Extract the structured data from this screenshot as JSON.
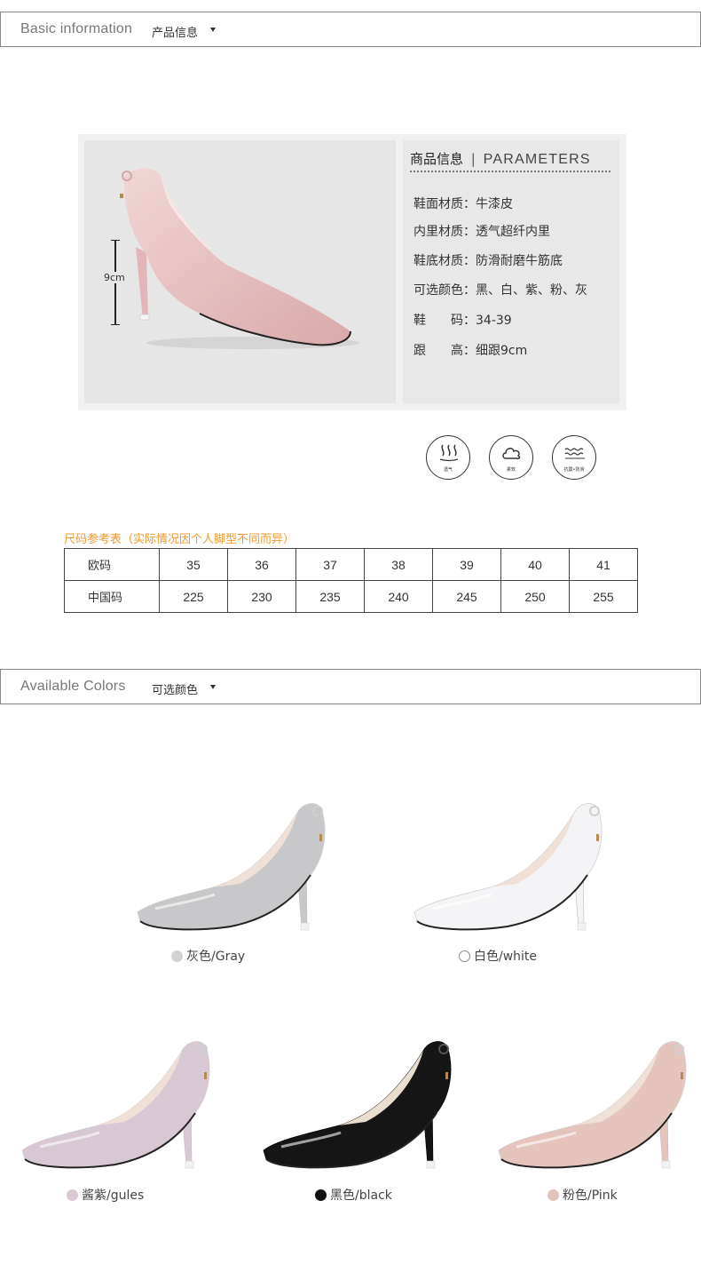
{
  "basic_header": {
    "en": "Basic information",
    "cn": "产品信息"
  },
  "parameters": {
    "title_cn": "商品信息",
    "title_sep": "|",
    "title_en": "PARAMETERS",
    "rows": [
      "鞋面材质：牛漆皮",
      "内里材质：透气超纤内里",
      "鞋底材质：防滑耐磨牛筋底",
      "可选颜色：黑、白、紫、粉、灰",
      "鞋　　码：34-39",
      "跟　　高：细跟9cm"
    ],
    "heel_height_label": "9cm"
  },
  "features": [
    {
      "icon": "breathable-icon",
      "label": "透气"
    },
    {
      "icon": "soft-cloud-icon",
      "label": "柔软"
    },
    {
      "icon": "anti-slip-icon",
      "label": "抗震•防滑"
    }
  ],
  "size_chart": {
    "title": "尺码参考表（实际情况因个人脚型不同而异）",
    "rows": [
      {
        "label": "欧码",
        "values": [
          "35",
          "36",
          "37",
          "38",
          "39",
          "40",
          "41"
        ]
      },
      {
        "label": "中国码",
        "values": [
          "225",
          "230",
          "235",
          "240",
          "245",
          "250",
          "255"
        ]
      }
    ]
  },
  "colors_header": {
    "en": "Available Colors",
    "cn": "可选颜色"
  },
  "colors": [
    {
      "label": "灰色/Gray",
      "swatch": "#d2d2d2",
      "shoe": "#c8c8ca"
    },
    {
      "label": "白色/white",
      "swatch": "#ffffff",
      "shoe": "#f4f4f6"
    },
    {
      "label": "酱紫/gules",
      "swatch": "#d9cad6",
      "shoe": "#d8c8d4"
    },
    {
      "label": "黑色/black",
      "swatch": "#111111",
      "shoe": "#151515"
    },
    {
      "label": "粉色/Pink",
      "swatch": "#e2c2bc",
      "shoe": "#e6c4be"
    }
  ]
}
